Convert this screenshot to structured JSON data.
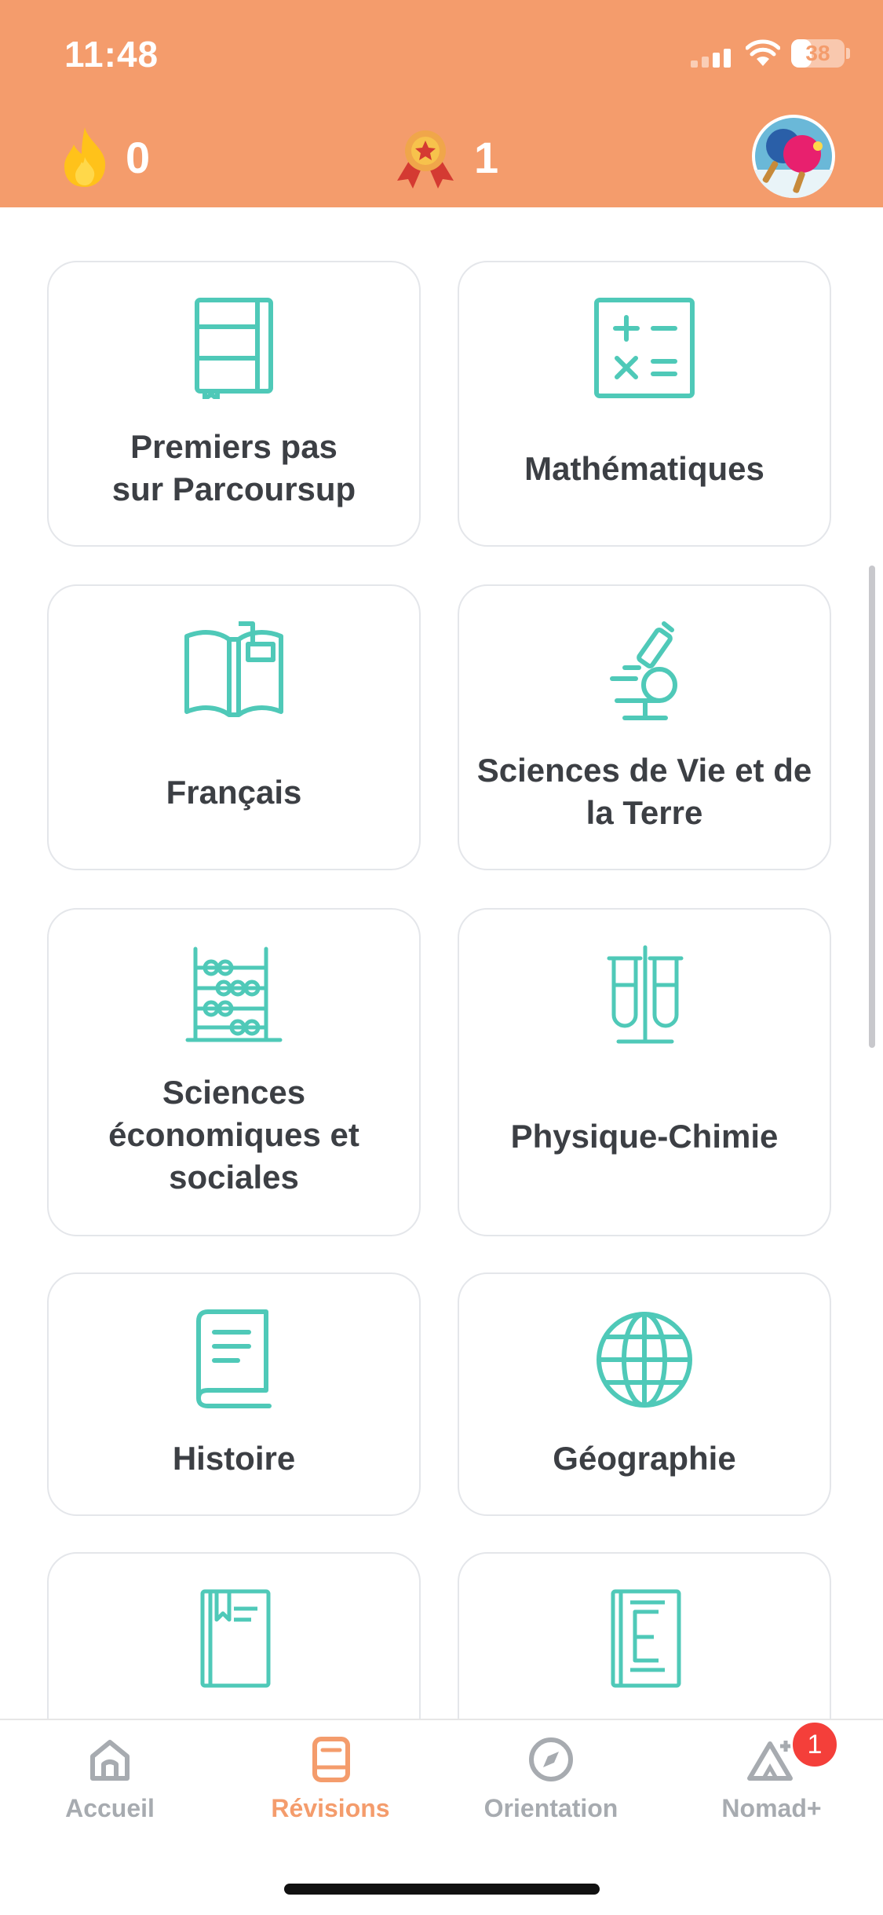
{
  "status_bar": {
    "time": "11:48",
    "battery_level": "38",
    "battery_fraction": 0.38
  },
  "header": {
    "streak_count": "0",
    "medal_count": "1",
    "streak_icon": "flame-icon",
    "medal_icon": "medal-icon",
    "background_color": "#f49c6c"
  },
  "accent_color": "#4fc9b8",
  "cards": [
    {
      "label": "Premiers pas\nsur Parcoursup",
      "icon": "notebook-icon"
    },
    {
      "label": "Mathématiques",
      "icon": "calculator-icon"
    },
    {
      "label": "Français",
      "icon": "open-book-icon"
    },
    {
      "label": "Sciences de Vie et de\nla Terre",
      "icon": "microscope-icon"
    },
    {
      "label": "Sciences\néconomiques et\nsociales",
      "icon": "abacus-icon"
    },
    {
      "label": "Physique-Chimie",
      "icon": "test-tubes-icon"
    },
    {
      "label": "Histoire",
      "icon": "history-book-icon"
    },
    {
      "label": "Géographie",
      "icon": "globe-icon"
    },
    {
      "label": "",
      "icon": "bookmark-book-icon"
    },
    {
      "label": "",
      "icon": "letter-e-book-icon"
    }
  ],
  "tabs": [
    {
      "label": "Accueil",
      "icon": "home-icon",
      "active": false
    },
    {
      "label": "Révisions",
      "icon": "book-icon",
      "active": true
    },
    {
      "label": "Orientation",
      "icon": "compass-icon",
      "active": false
    },
    {
      "label": "Nomad+",
      "icon": "tent-plus-icon",
      "active": false,
      "badge": "1"
    }
  ]
}
